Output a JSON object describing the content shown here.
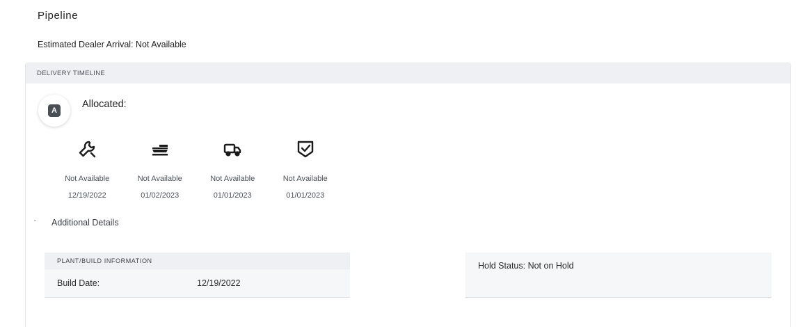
{
  "page": {
    "title": "Pipeline",
    "estimated_arrival": "Estimated Dealer Arrival: Not Available"
  },
  "timeline": {
    "header": "DELIVERY TIMELINE",
    "status_letter": "A",
    "status_label": "Allocated:",
    "steps": [
      {
        "icon": "wrench-icon",
        "status": "Not Available",
        "date": "12/19/2022"
      },
      {
        "icon": "ship-icon",
        "status": "Not Available",
        "date": "01/02/2023"
      },
      {
        "icon": "truck-icon",
        "status": "Not Available",
        "date": "01/01/2023"
      },
      {
        "icon": "shield-check-icon",
        "status": "Not Available",
        "date": "01/01/2023"
      }
    ]
  },
  "details": {
    "toggle_label": "Additional Details",
    "plant": {
      "header": "PLANT/BUILD INFORMATION",
      "build_date_label": "Build Date:",
      "build_date_value": "12/19/2022"
    },
    "hold_status": "Hold Status: Not on Hold"
  },
  "colors": {
    "header_bg": "#eef0f3",
    "row_bg": "#f6f7f9",
    "badge_bg": "#4a4f56",
    "text": "#2a2a2a"
  }
}
